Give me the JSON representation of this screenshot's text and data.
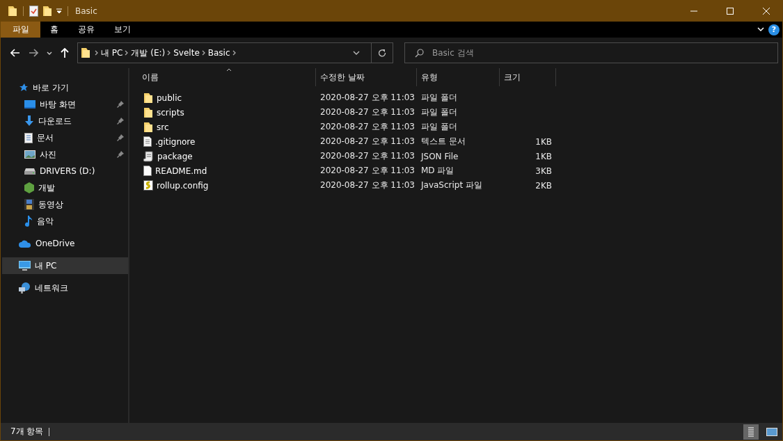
{
  "window": {
    "title": "Basic"
  },
  "ribbon": {
    "tabs": [
      {
        "label": "파일",
        "selected": true
      },
      {
        "label": "홈",
        "selected": false
      },
      {
        "label": "공유",
        "selected": false
      },
      {
        "label": "보기",
        "selected": false
      }
    ],
    "help": "?"
  },
  "address": {
    "crumbs": [
      "내 PC",
      "개발 (E:)",
      "Svelte",
      "Basic"
    ]
  },
  "search": {
    "placeholder": "Basic 검색"
  },
  "sidebar": {
    "items": [
      {
        "label": "바로 가기",
        "kind": "star",
        "selected": false,
        "children": [
          {
            "label": "바탕 화면",
            "kind": "desktop",
            "pinned": true,
            "selected": false
          },
          {
            "label": "다운로드",
            "kind": "download",
            "pinned": true,
            "selected": false
          },
          {
            "label": "문서",
            "kind": "document",
            "pinned": true,
            "selected": false
          },
          {
            "label": "사진",
            "kind": "pictures",
            "pinned": true,
            "selected": false
          },
          {
            "label": "DRIVERS (D:)",
            "kind": "drive",
            "pinned": false,
            "selected": false
          },
          {
            "label": "개발",
            "kind": "hexagon",
            "pinned": false,
            "selected": false
          },
          {
            "label": "동영상",
            "kind": "film",
            "pinned": false,
            "selected": false
          },
          {
            "label": "음악",
            "kind": "music",
            "pinned": false,
            "selected": false
          }
        ]
      },
      {
        "label": "OneDrive",
        "kind": "cloud",
        "selected": false
      },
      {
        "label": "내 PC",
        "kind": "pc",
        "selected": true
      },
      {
        "label": "네트워크",
        "kind": "network",
        "selected": false
      }
    ]
  },
  "table": {
    "columns": [
      "이름",
      "수정한 날짜",
      "유형",
      "크기"
    ],
    "rows": [
      {
        "kind": "folder",
        "name": "public",
        "date": "2020-08-27 오후 11:03",
        "type": "파일 폴더"
      },
      {
        "kind": "folder",
        "name": "scripts",
        "date": "2020-08-27 오후 11:03",
        "type": "파일 폴더"
      },
      {
        "kind": "folder",
        "name": "src",
        "date": "2020-08-27 오후 11:03",
        "type": "파일 폴더"
      },
      {
        "kind": "text",
        "name": ".gitignore",
        "date": "2020-08-27 오후 11:03",
        "type": "텍스트 문서",
        "size": "1KB"
      },
      {
        "kind": "json",
        "name": "package",
        "date": "2020-08-27 오후 11:03",
        "type": "JSON File",
        "size": "1KB"
      },
      {
        "kind": "file",
        "name": "README.md",
        "date": "2020-08-27 오후 11:03",
        "type": "MD 파일",
        "size": "3KB"
      },
      {
        "kind": "script",
        "name": "rollup.config",
        "date": "2020-08-27 오후 11:03",
        "type": "JavaScript 파일",
        "size": "2KB"
      }
    ]
  },
  "status_bar": {
    "count": "7개 항목",
    "views": [
      {
        "selected": true
      },
      {
        "selected": false
      }
    ]
  }
}
